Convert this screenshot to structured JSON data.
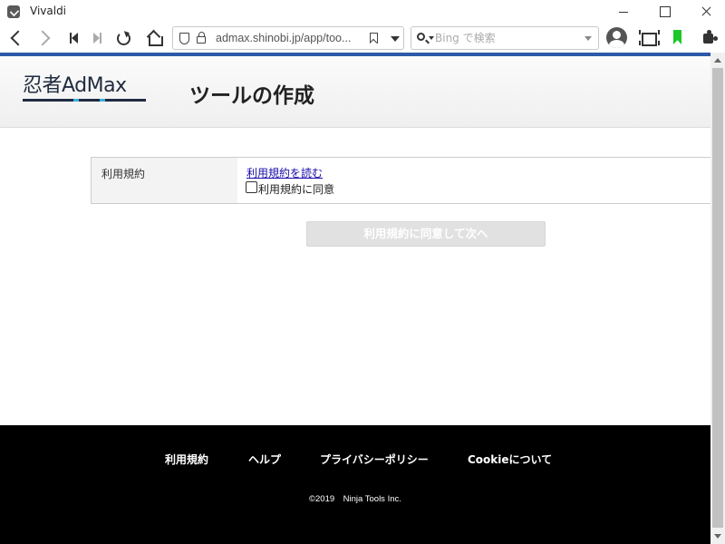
{
  "window": {
    "title": "Vivaldi"
  },
  "toolbar": {
    "url": "admax.shinobi.jp/app/too...",
    "search_placeholder": "Bing で検索"
  },
  "page": {
    "logo_text": "忍者AdMax",
    "title": "ツールの作成",
    "terms": {
      "label": "利用規約",
      "read_link": "利用規約を読む",
      "agree_label": "利用規約に同意",
      "agree_checked": false
    },
    "next_button": "利用規約に同意して次へ"
  },
  "footer": {
    "links": [
      "利用規約",
      "ヘルプ",
      "プライバシーポリシー",
      "Cookieについて"
    ],
    "copyright": "©2019　Ninja Tools Inc."
  },
  "colors": {
    "accent": "#2d5aa8",
    "footer_bg": "#000000",
    "link": "#1a0dab",
    "disabled_button": "#e1e1e1",
    "reader_icon": "#1cc72a"
  }
}
